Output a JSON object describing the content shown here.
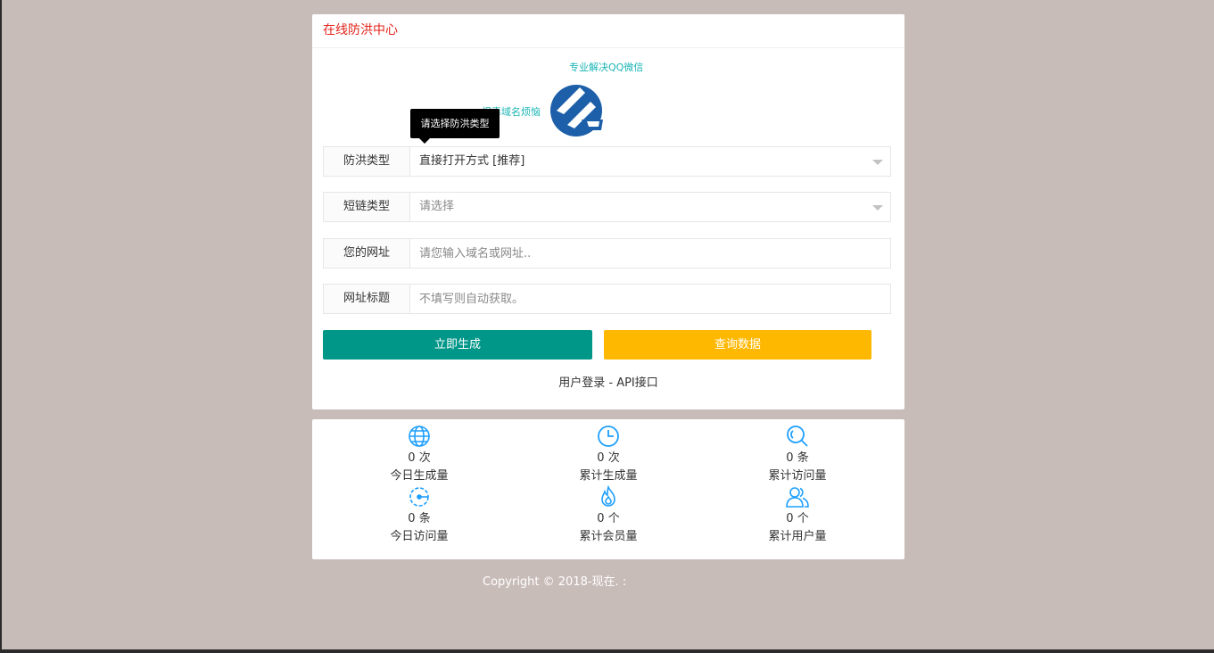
{
  "header": {
    "title": "在线防洪中心"
  },
  "taglines": [
    "专业解决QQ微信",
    "报毒域名烦恼"
  ],
  "tooltip": "请选择防洪类型",
  "form": {
    "type_label": "防洪类型",
    "type_value": "直接打开方式 [推荐]",
    "short_label": "短链类型",
    "short_placeholder": "请选择",
    "url_label": "您的网址",
    "url_placeholder": "请您输入域名或网址..",
    "title_label": "网址标题",
    "title_placeholder": "不填写则自动获取。"
  },
  "buttons": {
    "generate": "立即生成",
    "query": "查询数据"
  },
  "links": {
    "login": "用户登录",
    "separator": " - ",
    "api": "API接口"
  },
  "stats": [
    {
      "icon": "globe-icon",
      "count": "0 次",
      "label": "今日生成量"
    },
    {
      "icon": "clock-icon",
      "count": "0 次",
      "label": "累计生成量"
    },
    {
      "icon": "search-icon",
      "count": "0 条",
      "label": "累计访问量"
    },
    {
      "icon": "gauge-icon",
      "count": "0 条",
      "label": "今日访问量"
    },
    {
      "icon": "fire-icon",
      "count": "0 个",
      "label": "累计会员量"
    },
    {
      "icon": "users-icon",
      "count": "0 个",
      "label": "累计用户量"
    }
  ],
  "colors": {
    "background": "#c8bcb9",
    "header_text": "#e2231a",
    "tagline": "#1bb5b5",
    "generate_button": "#009688",
    "query_button": "#ffb800",
    "stat_icon": "#1e9fff"
  },
  "copyright": "Copyright © 2018-现在. :"
}
